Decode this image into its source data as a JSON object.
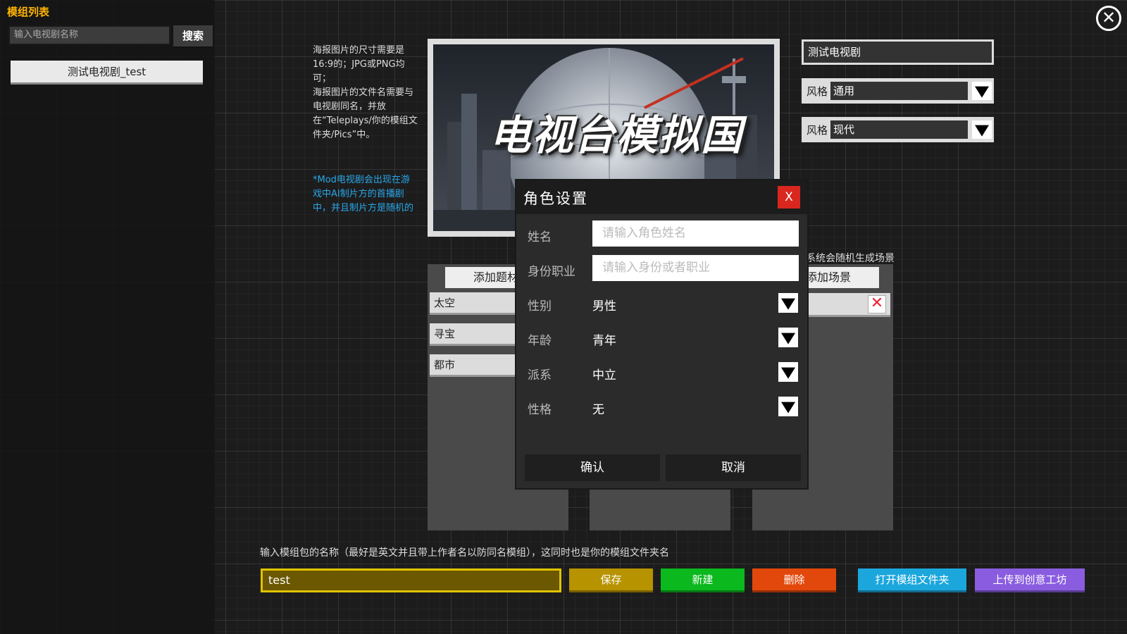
{
  "sidebar": {
    "title": "模组列表",
    "search_placeholder": "输入电视剧名称",
    "search_button": "搜索",
    "mods": [
      {
        "label": "测试电视剧_test"
      }
    ]
  },
  "poster": {
    "info": "海报图片的尺寸需要是16:9的；JPG或PNG均可；\n海报图片的文件名需要与电视剧同名，并放在“Teleplays/你的模组文件夹/Pics”中。",
    "note": "*Mod电视剧会出现在游戏中AI制片方的首播剧中，并且制片方是随机的",
    "title_art": "电视台模拟国"
  },
  "details": {
    "tv_name": "测试电视剧",
    "style_label": "风格",
    "style_values": [
      "通用",
      "现代"
    ]
  },
  "genres": {
    "add_button": "添加题材",
    "items": [
      "太空",
      "寻宝",
      "都市"
    ]
  },
  "scenes": {
    "hint": "系统会随机生成场景",
    "add_button": "添加场景"
  },
  "modal": {
    "title": "角色设置",
    "close": "X",
    "name_label": "姓名",
    "name_placeholder": "请输入角色姓名",
    "job_label": "身份职业",
    "job_placeholder": "请输入身份或者职业",
    "gender_label": "性别",
    "gender_value": "男性",
    "age_label": "年龄",
    "age_value": "青年",
    "faction_label": "派系",
    "faction_value": "中立",
    "personality_label": "性格",
    "personality_value": "无",
    "confirm": "确认",
    "cancel": "取消"
  },
  "bottom": {
    "hint": "输入模组包的名称（最好是英文并且带上作者名以防同名模组），这同时也是你的模组文件夹名",
    "package_name": "test",
    "save": "保存",
    "new": "新建",
    "delete": "删除",
    "open_folder": "打开模组文件夹",
    "upload": "上传到创意工坊"
  },
  "colors": {
    "accent_title": "#ffb400",
    "save": "#b89300",
    "new": "#0bb81e",
    "delete": "#e2480c",
    "open_folder": "#1ca7dc",
    "upload": "#8a5de0",
    "modal_close": "#d9261e"
  }
}
